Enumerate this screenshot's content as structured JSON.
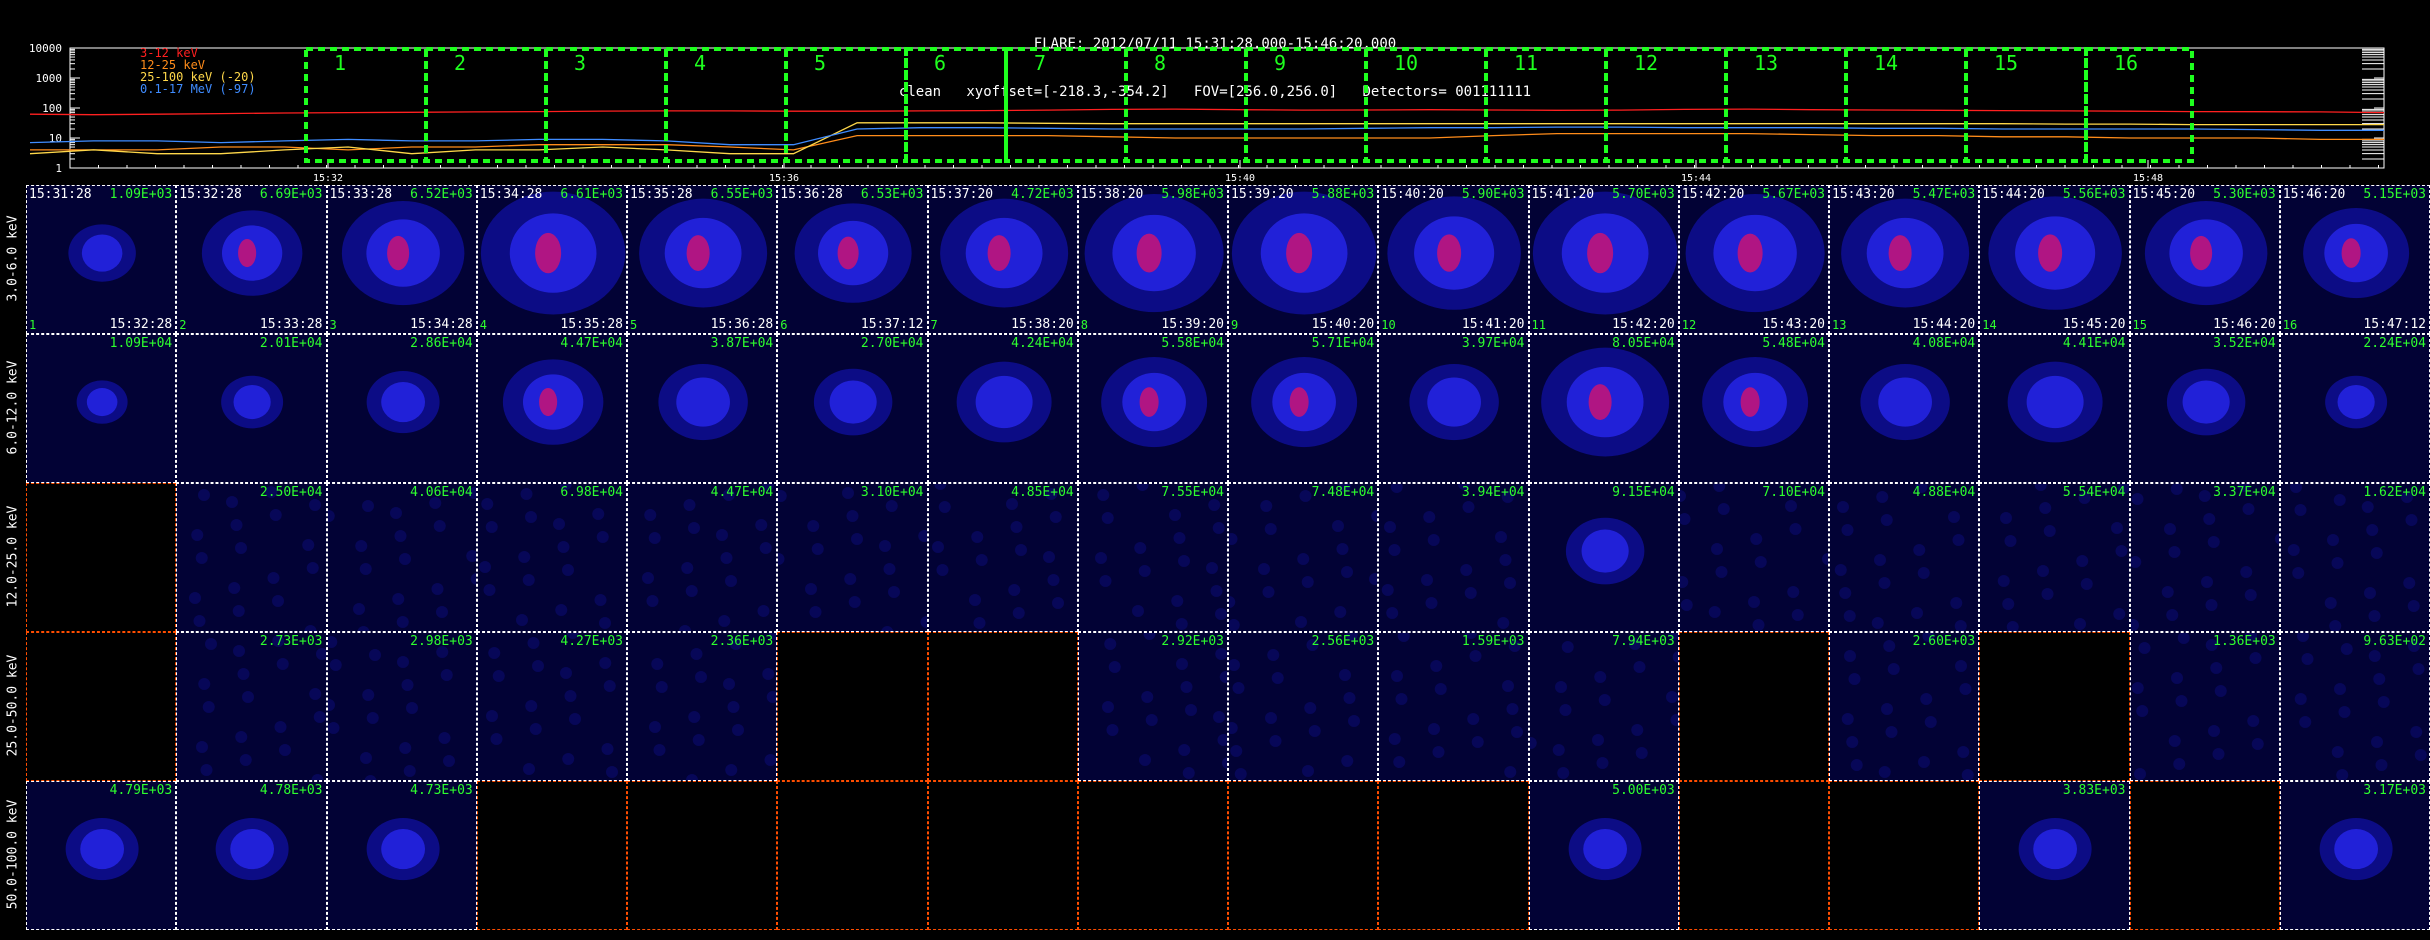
{
  "header": {
    "line1": "FLARE: 2012/07/11 15:31:28.000-15:46:20.000",
    "line2": "clean   xyoffset=[-218.3,-354.2]   FOV=[256.0,256.0]   Detectors= 001111111"
  },
  "chart_data": [
    {
      "type": "line",
      "name": "lightcurve",
      "yscale": "log",
      "ylim": [
        1,
        10000
      ],
      "ytick_labels": [
        "10000",
        "1000",
        "100",
        "10",
        "1"
      ],
      "xtick_labels": [
        "15:32",
        "15:36",
        "15:40",
        "15:44",
        "15:48"
      ],
      "legend": [
        {
          "label": "3-12 keV",
          "color": "#ff2020"
        },
        {
          "label": "12-25 keV",
          "color": "#ff8c1a"
        },
        {
          "label": "25-100 keV (-20)",
          "color": "#ffd84a"
        },
        {
          "label": "0.1-17 MeV (-97)",
          "color": "#3f8cff"
        }
      ],
      "interval_labels": [
        "1",
        "2",
        "3",
        "4",
        "5",
        "6",
        "7",
        "8",
        "9",
        "10",
        "11",
        "12",
        "13",
        "14",
        "15",
        "16"
      ],
      "series": [
        {
          "name": "3-12 keV",
          "color": "#ff2020",
          "values": [
            62,
            60,
            62,
            65,
            68,
            70,
            72,
            74,
            76,
            79,
            80,
            80,
            78,
            78,
            80,
            82,
            85,
            90,
            92,
            88,
            85,
            86,
            88,
            86,
            84,
            85,
            90,
            92,
            88,
            86,
            84,
            82,
            80,
            78,
            76,
            75,
            74,
            70
          ]
        },
        {
          "name": "12-25 keV",
          "color": "#ff8c1a",
          "values": [
            4,
            4,
            4,
            5,
            5,
            4,
            5,
            5,
            6,
            6,
            6,
            5,
            4,
            12,
            12,
            12,
            12,
            11,
            10,
            10,
            10,
            10,
            10,
            12,
            14,
            14,
            14,
            14,
            13,
            12,
            12,
            11,
            11,
            10,
            10,
            10,
            9,
            9
          ]
        },
        {
          "name": "25-100 keV (-20)",
          "color": "#ffd84a",
          "values": [
            3,
            4,
            3,
            3,
            4,
            5,
            3,
            4,
            4,
            5,
            4,
            3,
            3,
            32,
            32,
            32,
            31,
            30,
            30,
            30,
            30,
            30,
            30,
            30,
            30,
            30,
            30,
            30,
            30,
            30,
            30,
            30,
            29,
            29,
            28,
            28,
            28,
            28
          ]
        },
        {
          "name": "0.1-17 MeV (-97)",
          "color": "#3f8cff",
          "values": [
            7,
            8,
            8,
            7,
            8,
            9,
            8,
            8,
            9,
            9,
            8,
            6,
            6,
            20,
            22,
            22,
            21,
            20,
            20,
            20,
            20,
            21,
            22,
            22,
            23,
            23,
            22,
            22,
            22,
            21,
            21,
            20,
            20,
            20,
            20,
            19,
            18,
            18
          ]
        }
      ]
    },
    {
      "type": "heatmap",
      "name": "image-grid",
      "rows": [
        "3.0-6.0 keV",
        "6.0-12.0 keV",
        "12.0-25.0 keV",
        "25.0-50.0 keV",
        "50.0-100.0 keV"
      ],
      "intervals": [
        {
          "start": "15:31:28",
          "end": "15:32:28"
        },
        {
          "start": "15:32:28",
          "end": "15:33:28"
        },
        {
          "start": "15:33:28",
          "end": "15:34:28"
        },
        {
          "start": "15:34:28",
          "end": "15:35:28"
        },
        {
          "start": "15:35:28",
          "end": "15:36:28"
        },
        {
          "start": "15:36:28",
          "end": "15:37:12"
        },
        {
          "start": "15:37:20",
          "end": "15:38:20"
        },
        {
          "start": "15:38:20",
          "end": "15:39:20"
        },
        {
          "start": "15:39:20",
          "end": "15:40:20"
        },
        {
          "start": "15:40:20",
          "end": "15:41:20"
        },
        {
          "start": "15:41:20",
          "end": "15:42:20"
        },
        {
          "start": "15:42:20",
          "end": "15:43:20"
        },
        {
          "start": "15:43:20",
          "end": "15:44:20"
        },
        {
          "start": "15:44:20",
          "end": "15:45:20"
        },
        {
          "start": "15:45:20",
          "end": "15:46:20"
        },
        {
          "start": "15:46:20",
          "end": "15:47:12"
        }
      ],
      "cells": [
        [
          {
            "index": "1",
            "value": "1.09E+03"
          },
          {
            "index": "2",
            "value": "6.69E+03"
          },
          {
            "index": "3",
            "value": "6.52E+03"
          },
          {
            "index": "4",
            "value": "6.61E+03"
          },
          {
            "index": "5",
            "value": "6.55E+03"
          },
          {
            "index": "6",
            "value": "6.53E+03"
          },
          {
            "index": "7",
            "value": "4.72E+03"
          },
          {
            "index": "8",
            "value": "5.98E+03"
          },
          {
            "index": "9",
            "value": "5.88E+03"
          },
          {
            "index": "10",
            "value": "5.90E+03"
          },
          {
            "index": "11",
            "value": "5.70E+03"
          },
          {
            "index": "12",
            "value": "5.67E+03"
          },
          {
            "index": "13",
            "value": "5.47E+03"
          },
          {
            "index": "14",
            "value": "5.56E+03"
          },
          {
            "index": "15",
            "value": "5.30E+03"
          },
          {
            "index": "16",
            "value": "5.15E+03"
          }
        ],
        [
          {
            "value": "1.09E+04"
          },
          {
            "value": "2.01E+04"
          },
          {
            "value": "2.86E+04"
          },
          {
            "value": "4.47E+04"
          },
          {
            "value": "3.87E+04"
          },
          {
            "value": "2.70E+04"
          },
          {
            "value": "4.24E+04"
          },
          {
            "value": "5.58E+04"
          },
          {
            "value": "5.71E+04"
          },
          {
            "value": "3.97E+04"
          },
          {
            "value": "8.05E+04"
          },
          {
            "value": "5.48E+04"
          },
          {
            "value": "4.08E+04"
          },
          {
            "value": "4.41E+04"
          },
          {
            "value": "3.52E+04"
          },
          {
            "value": "2.24E+04"
          }
        ],
        [
          {
            "value": ""
          },
          {
            "value": "2.50E+04"
          },
          {
            "value": "4.06E+04"
          },
          {
            "value": "6.98E+04"
          },
          {
            "value": "4.47E+04"
          },
          {
            "value": "3.10E+04"
          },
          {
            "value": "4.85E+04"
          },
          {
            "value": "7.55E+04"
          },
          {
            "value": "7.48E+04"
          },
          {
            "value": "3.94E+04"
          },
          {
            "value": "9.15E+04"
          },
          {
            "value": "7.10E+04"
          },
          {
            "value": "4.88E+04"
          },
          {
            "value": "5.54E+04"
          },
          {
            "value": "3.37E+04"
          },
          {
            "value": "1.62E+04"
          }
        ],
        [
          {
            "value": ""
          },
          {
            "value": "2.73E+03"
          },
          {
            "value": "2.98E+03"
          },
          {
            "value": "4.27E+03"
          },
          {
            "value": "2.36E+03"
          },
          {
            "value": ""
          },
          {
            "value": ""
          },
          {
            "value": "2.92E+03"
          },
          {
            "value": "2.56E+03"
          },
          {
            "value": "1.59E+03"
          },
          {
            "value": "7.94E+03"
          },
          {
            "value": ""
          },
          {
            "value": "2.60E+03"
          },
          {
            "value": ""
          },
          {
            "value": "1.36E+03"
          },
          {
            "value": "9.63E+02"
          }
        ],
        [
          {
            "value": "4.79E+03"
          },
          {
            "value": "4.78E+03"
          },
          {
            "value": "4.73E+03"
          },
          {
            "value": ""
          },
          {
            "value": ""
          },
          {
            "value": ""
          },
          {
            "value": ""
          },
          {
            "value": ""
          },
          {
            "value": ""
          },
          {
            "value": ""
          },
          {
            "value": "5.00E+03"
          },
          {
            "value": ""
          },
          {
            "value": ""
          },
          {
            "value": "3.83E+03"
          },
          {
            "value": ""
          },
          {
            "value": "3.17E+03"
          }
        ]
      ],
      "source_intensity": [
        [
          0.25,
          0.55,
          0.75,
          0.95,
          0.8,
          0.7,
          0.8,
          0.9,
          0.95,
          0.85,
          0.95,
          0.9,
          0.8,
          0.85,
          0.75,
          0.6
        ],
        [
          0.1,
          0.2,
          0.3,
          0.55,
          0.45,
          0.35,
          0.5,
          0.6,
          0.6,
          0.45,
          0.8,
          0.6,
          0.45,
          0.5,
          0.35,
          0.2
        ],
        [
          0,
          0,
          0,
          0,
          0,
          0,
          0,
          0,
          0,
          0,
          0.35,
          0,
          0,
          0,
          0,
          0
        ],
        [
          0,
          0,
          0,
          0,
          0,
          0,
          0,
          0,
          0,
          0,
          0,
          0,
          0,
          0,
          0,
          0
        ],
        [
          0.3,
          0.3,
          0.3,
          0,
          0,
          0,
          0,
          0,
          0,
          0,
          0.3,
          0,
          0,
          0.3,
          0,
          0.3
        ]
      ],
      "cell_state": [
        [
          "image",
          "image",
          "image",
          "image",
          "image",
          "image",
          "image",
          "image",
          "image",
          "image",
          "image",
          "image",
          "image",
          "image",
          "image",
          "image"
        ],
        [
          "image",
          "image",
          "image",
          "image",
          "image",
          "image",
          "image",
          "image",
          "image",
          "image",
          "image",
          "image",
          "image",
          "image",
          "image",
          "image"
        ],
        [
          "empty",
          "image",
          "image",
          "image",
          "image",
          "image",
          "image",
          "image",
          "image",
          "image",
          "image",
          "image",
          "image",
          "image",
          "image",
          "image"
        ],
        [
          "empty",
          "image",
          "image",
          "image",
          "image",
          "empty",
          "empty",
          "image",
          "image",
          "image",
          "image",
          "empty",
          "image",
          "empty",
          "image",
          "image"
        ],
        [
          "image",
          "image",
          "image",
          "empty",
          "empty",
          "empty",
          "empty",
          "empty",
          "empty",
          "empty",
          "image",
          "empty",
          "empty",
          "image",
          "empty",
          "image"
        ]
      ]
    }
  ]
}
